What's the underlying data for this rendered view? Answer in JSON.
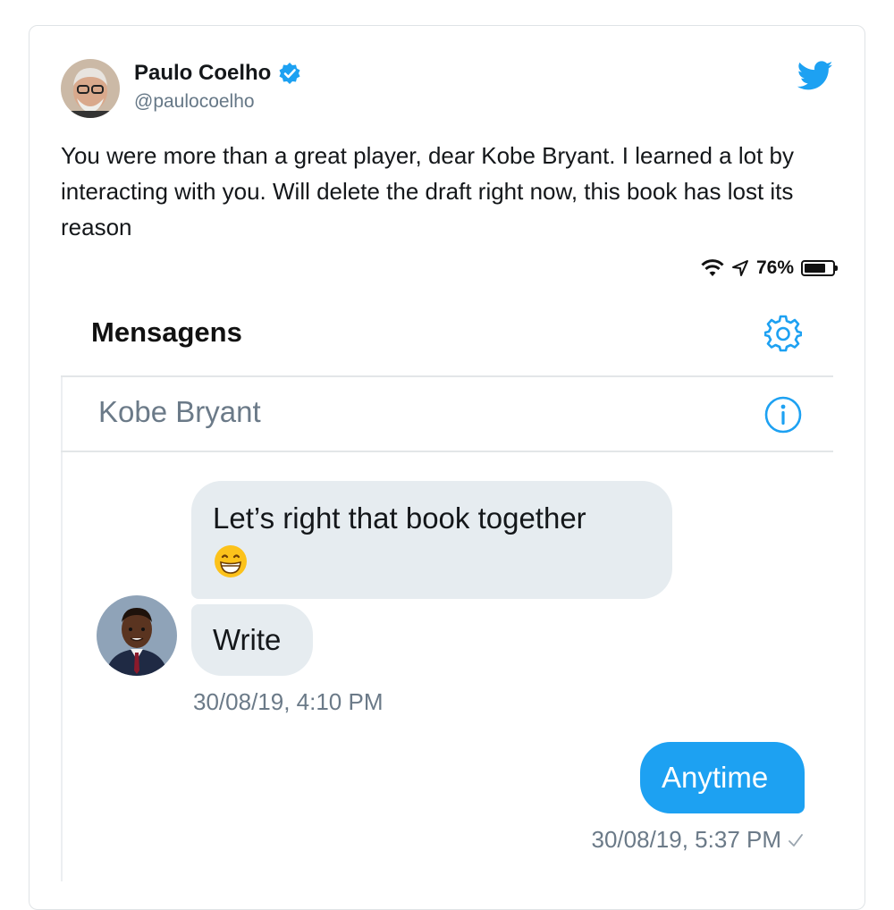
{
  "tweet": {
    "author_name": "Paulo Coelho",
    "handle": "@paulocoelho",
    "text": "You were more than a great player, dear Kobe Bryant. I learned a lot by interacting with you. Will delete the draft right now, this book has lost its reason",
    "brand_color": "#1da1f2"
  },
  "embedded_screenshot": {
    "status_bar": {
      "battery": "76%",
      "battery_level": 0.76
    },
    "header_title": "Mensagens",
    "chat_name": "Kobe Bryant",
    "messages": [
      {
        "text": "Let’s right that book together",
        "emoji": "grinning-face"
      },
      {
        "text": "Write"
      }
    ],
    "incoming_time": "30/08/19, 4:10 PM",
    "outgoing_message": "Anytime",
    "outgoing_time": "30/08/19, 5:37 PM",
    "icons": [
      "wifi-icon",
      "location-arrow-icon",
      "battery-icon",
      "gear-icon",
      "info-icon",
      "checkmark-icon"
    ],
    "colors": {
      "incoming_bubble": "#e6ecf0",
      "outgoing_bubble": "#1da1f2",
      "muted_text": "#6b7a88"
    }
  }
}
